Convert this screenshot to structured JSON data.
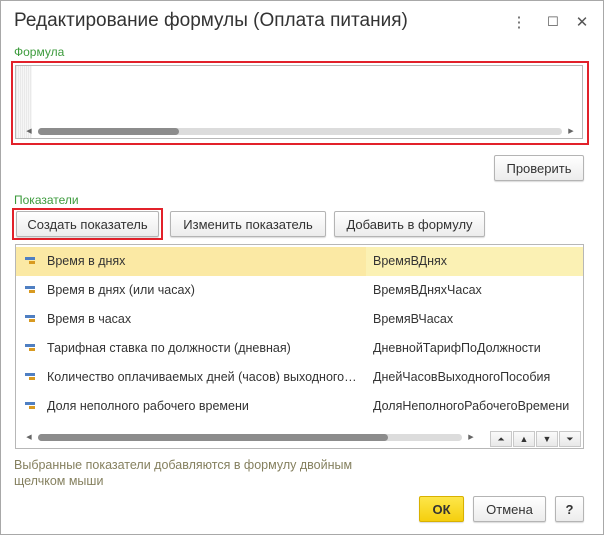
{
  "window": {
    "title": "Редактирование формулы (Оплата питания)",
    "more_glyph": "⋮",
    "maximize_glyph": "☐",
    "close_glyph": "✕"
  },
  "formula": {
    "label": "Формула",
    "value": "",
    "scroll_position": 0.27
  },
  "check_button": "Проверить",
  "indicators": {
    "label": "Показатели",
    "create_button": "Создать показатель",
    "edit_button": "Изменить показатель",
    "add_button": "Добавить в формулу",
    "rows": [
      {
        "name": "Время в днях",
        "id": "ВремяВДнях",
        "selected": true
      },
      {
        "name": "Время в днях (или часах)",
        "id": "ВремяВДняхЧасах",
        "selected": false
      },
      {
        "name": "Время в часах",
        "id": "ВремяВЧасах",
        "selected": false
      },
      {
        "name": "Тарифная ставка по должности (дневная)",
        "id": "ДневнойТарифПоДолжности",
        "selected": false
      },
      {
        "name": "Количество оплачиваемых дней (часов) выходного пособия",
        "id": "ДнейЧасовВыходногоПособия",
        "selected": false
      },
      {
        "name": "Доля неполного рабочего времени",
        "id": "ДоляНеполногоРабочегоВремени",
        "selected": false
      }
    ],
    "nav": {
      "first": "⏶",
      "up": "▲",
      "down": "▼",
      "last": "⏷"
    }
  },
  "hint": "Выбранные показатели добавляются в формулу двойным щелчком мыши",
  "footer": {
    "ok_button": "ОК",
    "cancel_button": "Отмена",
    "help_button": "?"
  },
  "colors": {
    "accent_green": "#3c9b3c",
    "highlight_red": "#e2212a",
    "selected_row": "#fbf1b4",
    "ok_yellow": "#f5cf0e"
  }
}
